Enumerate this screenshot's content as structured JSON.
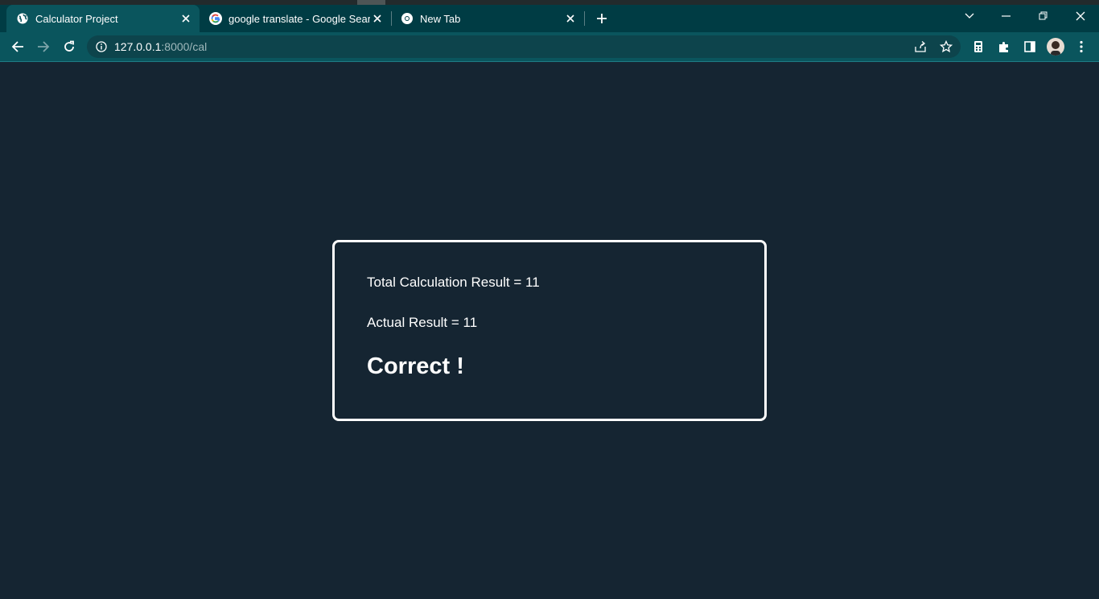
{
  "browser": {
    "tabs": [
      {
        "title": "Calculator Project",
        "favicon": "globe-icon",
        "active": true
      },
      {
        "title": "google translate - Google Search",
        "favicon": "google-g-icon",
        "active": false
      },
      {
        "title": "New Tab",
        "favicon": "chrome-icon",
        "active": false
      }
    ],
    "url": {
      "host": "127.0.0.1",
      "path": ":8000/cal"
    },
    "colors": {
      "titlebar": "#003c44",
      "toolbar": "#0a555d",
      "omnibox": "#0d444c"
    }
  },
  "page": {
    "background": "#152532",
    "total_label": "Total Calculation Result = 11",
    "actual_label": "Actual Result = 11",
    "verdict": "Correct !"
  }
}
